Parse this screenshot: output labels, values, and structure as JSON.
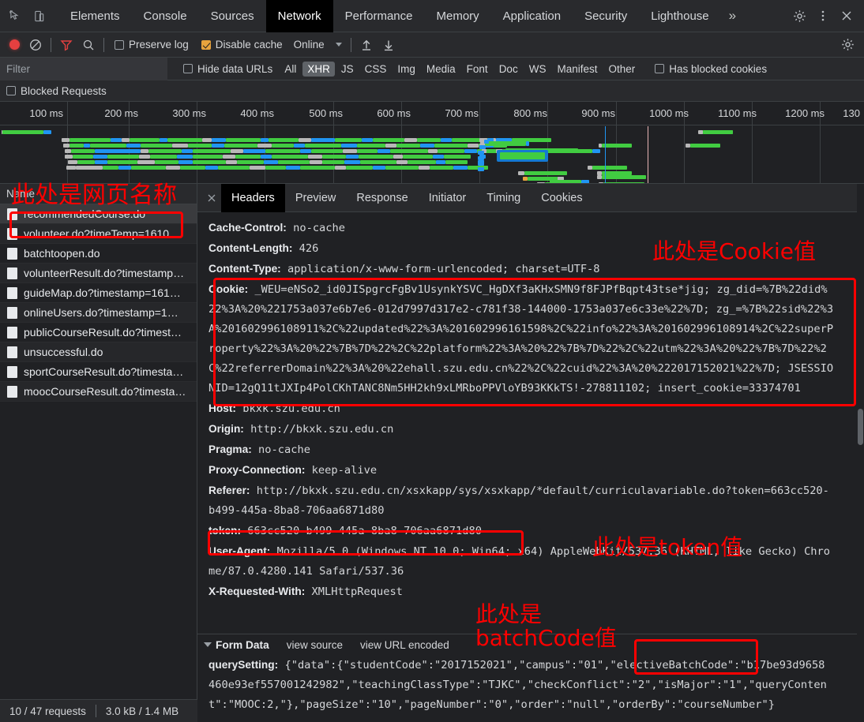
{
  "devtools": {
    "tabs": [
      {
        "label": "Elements",
        "active": false
      },
      {
        "label": "Console",
        "active": false
      },
      {
        "label": "Sources",
        "active": false
      },
      {
        "label": "Network",
        "active": true
      },
      {
        "label": "Performance",
        "active": false
      },
      {
        "label": "Memory",
        "active": false
      },
      {
        "label": "Application",
        "active": false
      },
      {
        "label": "Security",
        "active": false
      },
      {
        "label": "Lighthouse",
        "active": false
      }
    ],
    "more_label": "»",
    "icons": {
      "inspect": "inspect-element-icon",
      "device": "device-toolbar-icon",
      "settings": "gear-icon",
      "kebab": "more-options-icon",
      "close": "close-icon"
    }
  },
  "toolbar": {
    "record_label": "record-button",
    "clear_label": "clear-button",
    "filter_label": "filter-button",
    "search_label": "search-button",
    "preserve_log": "Preserve log",
    "preserve_log_checked": false,
    "disable_cache": "Disable cache",
    "disable_cache_checked": true,
    "throttle_value": "Online",
    "import_label": "import-har-icon",
    "export_label": "export-har-icon",
    "settings_label": "network-settings-icon"
  },
  "filter": {
    "placeholder": "Filter",
    "value": "",
    "hide_data_urls": "Hide data URLs",
    "hide_data_urls_checked": false,
    "types": [
      {
        "label": "All",
        "active": false
      },
      {
        "label": "XHR",
        "active": true
      },
      {
        "label": "JS",
        "active": false
      },
      {
        "label": "CSS",
        "active": false
      },
      {
        "label": "Img",
        "active": false
      },
      {
        "label": "Media",
        "active": false
      },
      {
        "label": "Font",
        "active": false
      },
      {
        "label": "Doc",
        "active": false
      },
      {
        "label": "WS",
        "active": false
      },
      {
        "label": "Manifest",
        "active": false
      },
      {
        "label": "Other",
        "active": false
      }
    ],
    "has_blocked_cookies": "Has blocked cookies",
    "has_blocked_cookies_checked": false,
    "blocked_requests": "Blocked Requests",
    "blocked_requests_checked": false
  },
  "overview": {
    "ticks": [
      "100 ms",
      "200 ms",
      "300 ms",
      "400 ms",
      "500 ms",
      "600 ms",
      "700 ms",
      "800 ms",
      "900 ms",
      "1000 ms",
      "1100 ms",
      "1200 ms",
      "130"
    ],
    "colors": {
      "receiving": "#41cc41",
      "waiting": "#2095f2",
      "stalled": "#b8b8b8",
      "dns": "#e8a33d",
      "dom_content_loaded": "#2095f2",
      "load": "#e8b4b4"
    }
  },
  "request_list": {
    "column_header": "Name",
    "rows": [
      {
        "name": "recommendedCourse.do",
        "selected": true
      },
      {
        "name": "volunteer.do?timeTemp=1610…",
        "selected": false
      },
      {
        "name": "batchtoopen.do",
        "selected": false
      },
      {
        "name": "volunteerResult.do?timestamp…",
        "selected": false
      },
      {
        "name": "guideMap.do?timestamp=161…",
        "selected": false
      },
      {
        "name": "onlineUsers.do?timestamp=1…",
        "selected": false
      },
      {
        "name": "publicCourseResult.do?timest…",
        "selected": false
      },
      {
        "name": "unsuccessful.do",
        "selected": false
      },
      {
        "name": "sportCourseResult.do?timesta…",
        "selected": false
      },
      {
        "name": "moocCourseResult.do?timesta…",
        "selected": false
      }
    ]
  },
  "details": {
    "tabs": [
      {
        "label": "Headers",
        "active": true
      },
      {
        "label": "Preview",
        "active": false
      },
      {
        "label": "Response",
        "active": false
      },
      {
        "label": "Initiator",
        "active": false
      },
      {
        "label": "Timing",
        "active": false
      },
      {
        "label": "Cookies",
        "active": false
      }
    ],
    "headers": [
      {
        "key": "Cache-Control:",
        "value": " no-cache"
      },
      {
        "key": "Content-Length:",
        "value": " 426"
      },
      {
        "key": "Content-Type:",
        "value": " application/x-www-form-urlencoded; charset=UTF-8"
      }
    ],
    "cookie": {
      "key": "Cookie:",
      "lines": [
        " _WEU=eNSo2_id0JISpgrcFgBv1UsynkYSVC_HgDXf3aKHxSMN9f8FJPfBqpt43tse*jig; zg_did=%7B%22did%",
        "22%3A%20%221753a037e6b7e6-012d7997d317e2-c781f38-144000-1753a037e6c33e%22%7D; zg_=%7B%22sid%22%3",
        "A%201602996108911%2C%22updated%22%3A%201602996161598%2C%22info%22%3A%201602996108914%2C%22superP",
        "roperty%22%3A%20%22%7B%7D%22%2C%22platform%22%3A%20%22%7B%7D%22%2C%22utm%22%3A%20%22%7B%7D%22%2",
        "C%22referrerDomain%22%3A%20%22ehall.szu.edu.cn%22%2C%22cuid%22%3A%20%222017152021%22%7D; JSESSIO",
        "NID=12gQ11tJXIp4PolCKhTANC8Nm5HH2kh9xLMRboPPVloYB93KKkTS!-278811102; insert_cookie=33374701"
      ]
    },
    "headers2": [
      {
        "key": "Host:",
        "value": " bkxk.szu.edu.cn"
      },
      {
        "key": "Origin:",
        "value": " http://bkxk.szu.edu.cn"
      },
      {
        "key": "Pragma:",
        "value": " no-cache"
      },
      {
        "key": "Proxy-Connection:",
        "value": " keep-alive"
      },
      {
        "key": "Referer:",
        "value": " http://bkxk.szu.edu.cn/xsxkapp/sys/xsxkapp/*default/curriculavariable.do?token=663cc520-"
      }
    ],
    "referer_cont": "b499-445a-8ba8-706aa6871d80",
    "token": {
      "key": "token:",
      "value": " 663cc520-b499-445a-8ba8-706aa6871d80"
    },
    "user_agent": {
      "key": "User-Agent:",
      "value": " Mozilla/5.0 (Windows NT 10.0; Win64; x64) AppleWebKit/537.36 (KHTML, like Gecko) Chro",
      "cont": "me/87.0.4280.141 Safari/537.36"
    },
    "x_requested_with": {
      "key": "X-Requested-With:",
      "value": " XMLHttpRequest"
    }
  },
  "form_data": {
    "title": "Form Data",
    "view_source": "view source",
    "view_url_encoded": "view URL encoded",
    "key": "querySetting:",
    "lines": [
      " {\"data\":{\"studentCode\":\"2017152021\",\"campus\":\"01\",\"electiveBatchCode\":\"b17be93d9658",
      "460e93ef557001242982\",\"teachingClassType\":\"TJKC\",\"checkConflict\":\"2\",\"isMajor\":\"1\",\"queryConten",
      "t\":\"MOOC:2,\"},\"pageSize\":\"10\",\"pageNumber\":\"0\",\"order\":\"null\",\"orderBy\":\"courseNumber\"}"
    ]
  },
  "status_bar": {
    "requests": "10 / 47 requests",
    "transferred": "3.0 kB / 1.4 MB"
  },
  "annotations": [
    {
      "id": "page-name",
      "text": "此处是网页名称"
    },
    {
      "id": "cookie-value",
      "text": "此处是Cookie值"
    },
    {
      "id": "token-value",
      "text": "此处是token值"
    },
    {
      "id": "batchcode-value-1",
      "text": "此处是"
    },
    {
      "id": "batchcode-value-2",
      "text": "batchCode值"
    }
  ],
  "colors": {
    "annotation": "#ff0000",
    "accent_active_tab": "#000000",
    "panel_bg": "#202124",
    "toolbar_bg": "#292a2d"
  }
}
